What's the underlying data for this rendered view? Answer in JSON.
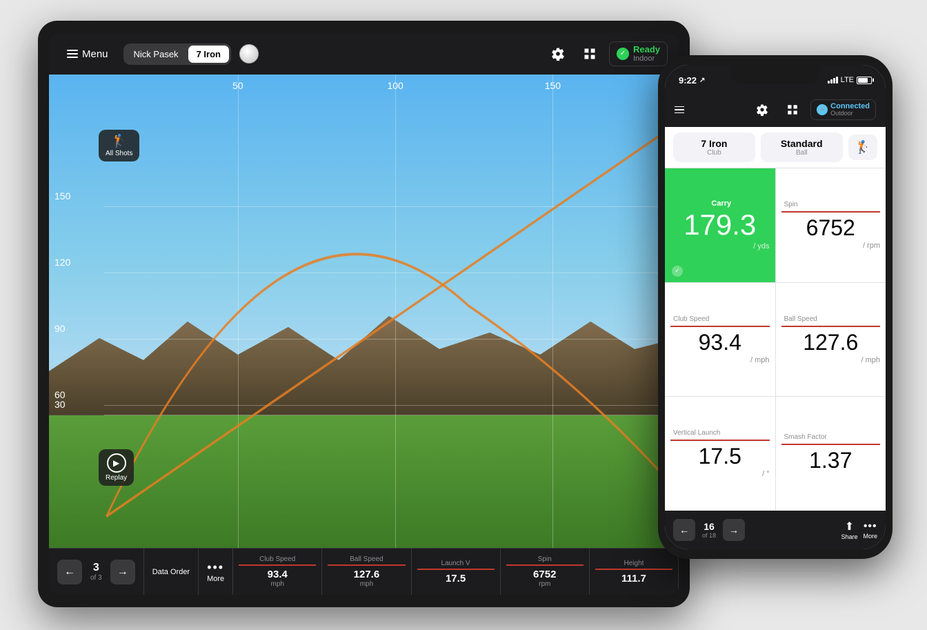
{
  "tablet": {
    "header": {
      "menu_label": "Menu",
      "player_name": "Nick Pasek",
      "club": "7 Iron",
      "ready_label": "Ready",
      "indoor_label": "Indoor"
    },
    "all_shots": {
      "label": "All Shots"
    },
    "grid": {
      "y_labels": [
        "150",
        "120",
        "90",
        "60",
        "30"
      ],
      "x_labels": [
        "50",
        "100",
        "150"
      ]
    },
    "footer": {
      "back_label": "←",
      "forward_label": "→",
      "shot_num": "3",
      "shot_of": "of 3",
      "data_order_label": "Data Order",
      "more_label": "More",
      "stats": [
        {
          "name": "Club Speed",
          "value": "93.4",
          "unit": "mph"
        },
        {
          "name": "Ball Speed",
          "value": "127.6",
          "unit": "mph"
        },
        {
          "name": "Launch V",
          "value": "17.5",
          "unit": ""
        },
        {
          "name": "Spin",
          "value": "6752",
          "unit": "rpm"
        },
        {
          "name": "Height",
          "value": "111.7",
          "unit": ""
        }
      ]
    },
    "replay": {
      "label": "Replay"
    }
  },
  "phone": {
    "status_bar": {
      "time": "9:22",
      "lte": "LTE"
    },
    "header": {
      "connected_label": "Connected",
      "outdoor_label": "Outdoor"
    },
    "club_selector": {
      "club_name": "7 Iron",
      "club_type": "Club",
      "ball_name": "Standard",
      "ball_type": "Ball",
      "player_type": "Player"
    },
    "stats": {
      "carry_label": "Carry",
      "carry_value": "179.3",
      "carry_unit": "/ yds",
      "spin_label": "Spin",
      "spin_value": "6752",
      "spin_unit": "/ rpm",
      "club_speed_label": "Club Speed",
      "club_speed_value": "93.4",
      "club_speed_unit": "/ mph",
      "ball_speed_label": "Ball Speed",
      "ball_speed_value": "127.6",
      "ball_speed_unit": "/ mph",
      "vertical_launch_label": "Vertical Launch",
      "vertical_launch_value": "17.5",
      "vertical_launch_unit": "/ °",
      "smash_factor_label": "Smash Factor",
      "smash_factor_value": "1.37",
      "smash_factor_unit": ""
    },
    "footer": {
      "shot_num": "16",
      "shot_of": "of 18",
      "share_label": "Share",
      "more_label": "More"
    }
  }
}
